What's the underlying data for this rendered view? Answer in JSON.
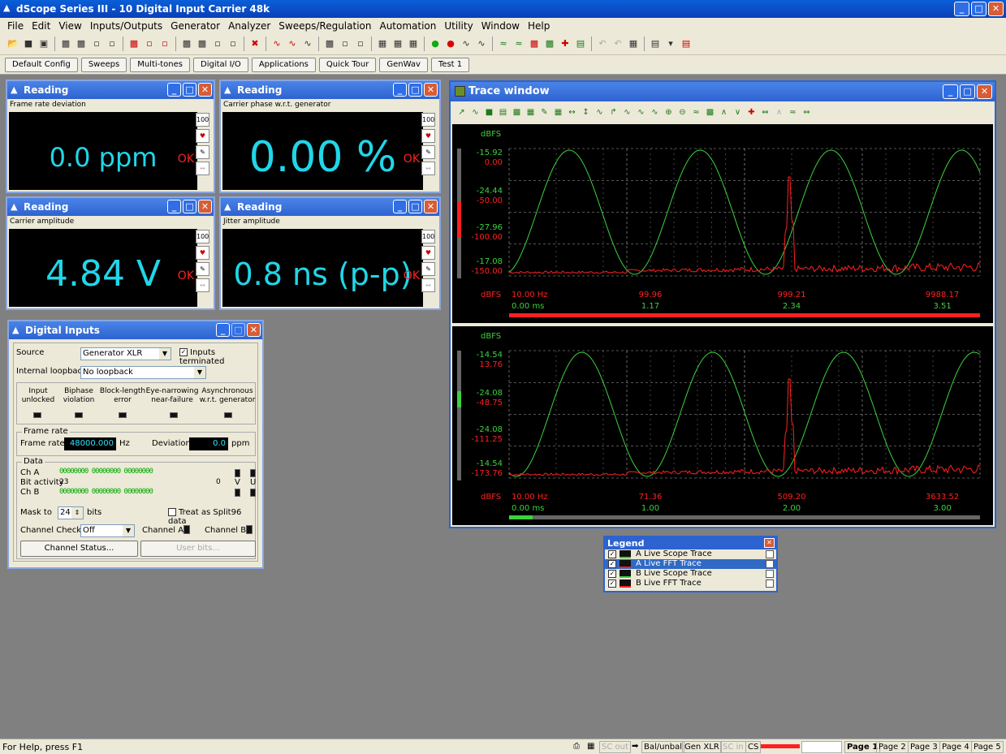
{
  "app": {
    "title": "dScope Series III - 10 Digital Input Carrier 48k"
  },
  "menu": [
    "File",
    "Edit",
    "View",
    "Inputs/Outputs",
    "Generator",
    "Analyzer",
    "Sweeps/Regulation",
    "Automation",
    "Utility",
    "Window",
    "Help"
  ],
  "quickbar": [
    "Default Config",
    "Sweeps",
    "Multi-tones",
    "Digital I/O",
    "Applications",
    "Quick Tour",
    "GenWav",
    "Test 1"
  ],
  "readings": [
    {
      "title": "Reading",
      "sub": "Frame rate deviation",
      "status": "OK",
      "value": "0.0 ppm"
    },
    {
      "title": "Reading",
      "sub": "Carrier phase w.r.t. generator",
      "status": "OK",
      "value": "0.00 %"
    },
    {
      "title": "Reading",
      "sub": "Carrier amplitude",
      "status": "OK",
      "value": "4.84 V"
    },
    {
      "title": "Reading",
      "sub": "Jitter amplitude",
      "status": "OK",
      "value": "0.8 ns (p-p)"
    }
  ],
  "digital_inputs": {
    "title": "Digital Inputs",
    "source_label": "Source",
    "source_value": "Generator XLR",
    "inputs_terminated": "Inputs terminated",
    "loopback_label": "Internal loopback",
    "loopback_value": "No loopback",
    "flags": [
      [
        "Input",
        "unlocked"
      ],
      [
        "Biphase",
        "violation"
      ],
      [
        "Block-length",
        "error"
      ],
      [
        "Eye-narrowing",
        "near-failure"
      ],
      [
        "Asynchronous",
        "w.r.t. generator"
      ]
    ],
    "frame_rate_group": "Frame rate",
    "frame_rate_label": "Frame rate",
    "frame_rate_value": "48000.000",
    "frame_rate_unit": "Hz",
    "deviation_label": "Deviation",
    "deviation_value": "0.0",
    "deviation_unit": "ppm",
    "data_group": "Data",
    "cha": "Ch A",
    "bit_activity": "Bit activity",
    "chb": "Ch B",
    "bits_a": "00000000 00000000 00000000",
    "bits_b": "00000000 00000000 00000000",
    "bit_hi": "23",
    "bit_lo": "0",
    "v": "V",
    "u": "U",
    "mask_label": "Mask to",
    "mask_value": "24",
    "mask_unit": "bits",
    "split96": "Treat as Split96 data",
    "channel_check_label": "Channel Check",
    "channel_check_value": "Off",
    "channel_a": "Channel A",
    "channel_b": "Channel B",
    "channel_status_btn": "Channel Status...",
    "user_bits_btn": "User bits..."
  },
  "trace": {
    "title": "Trace window",
    "top": {
      "unit": "dBFS",
      "y_green": [
        "-15.92",
        "-24.44",
        "-27.96",
        "-17.08"
      ],
      "y_red": [
        "0.00",
        "-50.00",
        "-100.00",
        "-150.00"
      ],
      "x_red": [
        "10.00 Hz",
        "99.96",
        "999.21",
        "9988.17"
      ],
      "x_green": [
        "0.00 ms",
        "1.17",
        "2.34",
        "3.51"
      ],
      "x_unit": "dBFS"
    },
    "bottom": {
      "unit": "dBFS",
      "y_green": [
        "-14.54",
        "-24.08",
        "-24.08",
        "-14.54"
      ],
      "y_red": [
        "13.76",
        "-48.75",
        "-111.25",
        "-173.76"
      ],
      "x_red": [
        "10.00 Hz",
        "71.36",
        "509.20",
        "3633.52"
      ],
      "x_green": [
        "0.00 ms",
        "1.00",
        "2.00",
        "3.00"
      ],
      "x_unit": "dBFS"
    }
  },
  "legend": {
    "title": "Legend",
    "items": [
      "A Live Scope Trace",
      "A Live FFT Trace",
      "B Live Scope Trace",
      "B Live FFT Trace"
    ]
  },
  "status": {
    "help": "For Help, press F1",
    "sc_out": "SC out",
    "balunbal": "Bal/unbal",
    "gen": "Gen XLR",
    "sc_in": "SC in",
    "cs": "CS",
    "pages": [
      "Page 1",
      "Page 2",
      "Page 3",
      "Page 4",
      "Page 5"
    ]
  },
  "colors": {
    "green": "#3cd23c",
    "red": "#ff2020",
    "cyan": "#21d6e8"
  }
}
